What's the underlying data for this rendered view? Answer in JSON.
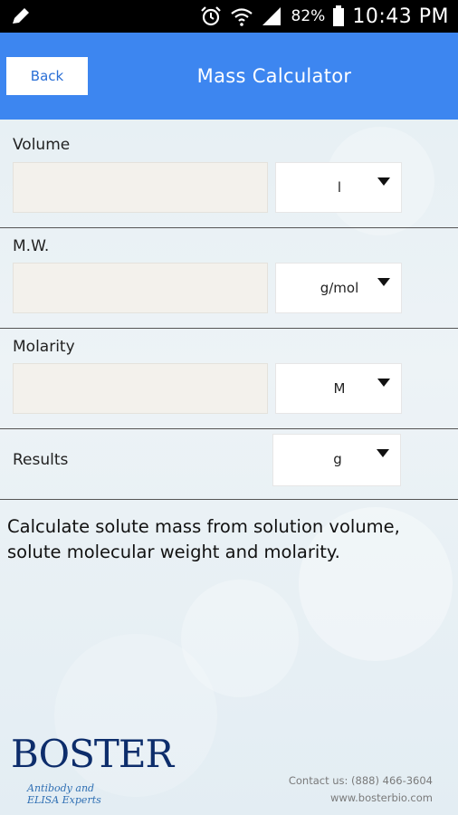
{
  "status_bar": {
    "left_icon": "pencil-icon",
    "icons": [
      "alarm-icon",
      "wifi-icon",
      "signal-icon"
    ],
    "battery_percent": "82%",
    "time": "10:43 PM"
  },
  "header": {
    "back_label": "Back",
    "title": "Mass Calculator",
    "color": "#3d86f0"
  },
  "form": {
    "volume": {
      "label": "Volume",
      "value": "",
      "unit": "l"
    },
    "mw": {
      "label": "M.W.",
      "value": "",
      "unit": "g/mol"
    },
    "molarity": {
      "label": "Molarity",
      "value": "",
      "unit": "M"
    },
    "results": {
      "label": "Results",
      "unit": "g"
    }
  },
  "description": "Calculate solute mass from solution volume, solute molecular weight and molarity.",
  "footer": {
    "logo_text": "BOSTER",
    "logo_tagline": "Antibody and ELISA Experts",
    "contact": "Contact us: (888) 466-3604",
    "website": "www.bosterbio.com"
  }
}
